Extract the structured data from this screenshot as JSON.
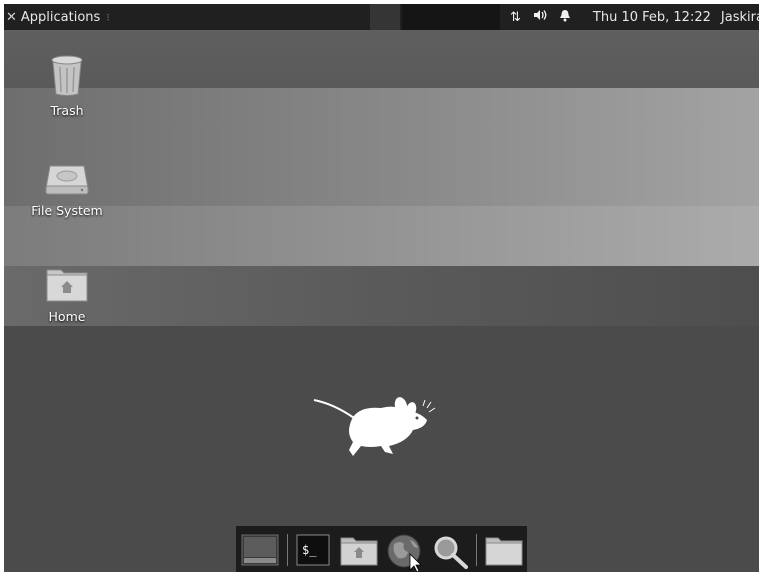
{
  "panel": {
    "apps_icon": "xfce-mouse-icon",
    "applications_label": "Applications",
    "network_icon": "network-arrows-icon",
    "volume_icon": "volume-icon",
    "notification_icon": "bell-icon",
    "clock": "Thu 10 Feb, 12:22",
    "user": "Jaskiran"
  },
  "desktop": {
    "icons": [
      {
        "label": "Trash",
        "icon": "trash-icon"
      },
      {
        "label": "File System",
        "icon": "hard-drive-icon"
      },
      {
        "label": "Home",
        "icon": "home-folder-icon"
      }
    ],
    "logo": "xfce-mouse-logo"
  },
  "dock": {
    "items": [
      {
        "icon": "show-desktop-icon"
      },
      {
        "icon": "terminal-icon",
        "text": "$_"
      },
      {
        "icon": "file-manager-icon"
      },
      {
        "icon": "web-browser-icon"
      },
      {
        "icon": "search-icon"
      },
      {
        "icon": "folder-icon"
      }
    ]
  }
}
